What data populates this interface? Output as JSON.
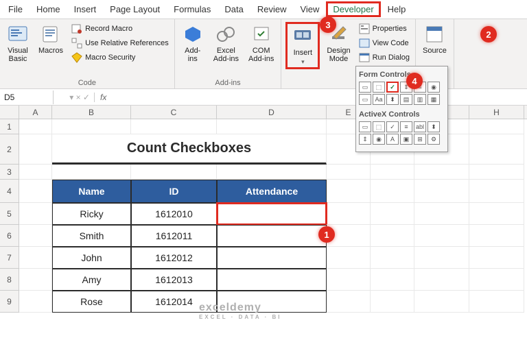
{
  "menu": {
    "items": [
      "File",
      "Home",
      "Insert",
      "Page Layout",
      "Formulas",
      "Data",
      "Review",
      "View",
      "Developer",
      "Help"
    ]
  },
  "ribbon": {
    "code": {
      "visualBasic": "Visual\nBasic",
      "macros": "Macros",
      "recordMacro": "Record Macro",
      "useRelative": "Use Relative References",
      "macroSecurity": "Macro Security",
      "label": "Code"
    },
    "addins": {
      "addins": "Add-\nins",
      "excel": "Excel\nAdd-ins",
      "com": "COM\nAdd-ins",
      "label": "Add-ins"
    },
    "controls": {
      "insert": "Insert",
      "design": "Design\nMode",
      "properties": "Properties",
      "viewCode": "View Code",
      "runDialog": "Run Dialog"
    },
    "xml": {
      "source": "Source"
    },
    "formSection": "Form Controls",
    "activexSection": "ActiveX Controls"
  },
  "namebox": "D5",
  "fx": "fx",
  "cols": {
    "A": 48,
    "B": 115,
    "C": 125,
    "D": 160,
    "E": 64,
    "F": 64,
    "G": 80,
    "H": 80
  },
  "table": {
    "title": "Count Checkboxes",
    "headers": [
      "Name",
      "ID",
      "Attendance"
    ],
    "rows": [
      {
        "name": "Ricky",
        "id": "1612010"
      },
      {
        "name": "Smith",
        "id": "1612011"
      },
      {
        "name": "John",
        "id": "1612012"
      },
      {
        "name": "Amy",
        "id": "1612013"
      },
      {
        "name": "Rose",
        "id": "1612014"
      }
    ]
  },
  "markers": {
    "m1": "1",
    "m2": "2",
    "m3": "3",
    "m4": "4"
  },
  "watermark": {
    "main": "exceldemy",
    "sub": "EXCEL · DATA · BI"
  }
}
